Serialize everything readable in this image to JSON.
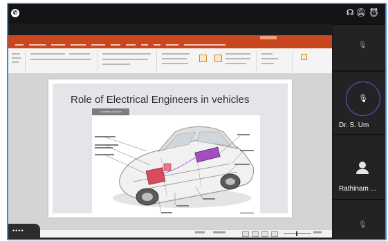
{
  "slide": {
    "title": "Role of Electrical Engineers in vehicles",
    "tag_button": "Overview Service"
  },
  "participants": [
    {
      "name": "Dr. S. Um",
      "speaking": true
    },
    {
      "name": "Rathinam ..."
    }
  ],
  "toolbar_icons": [
    "phone-icon",
    "headset-icon",
    "mute-bell-icon",
    "alarm-icon"
  ],
  "more_badge": "••••",
  "accent": "#2b93d6",
  "ppt_accent": "#c9461f"
}
